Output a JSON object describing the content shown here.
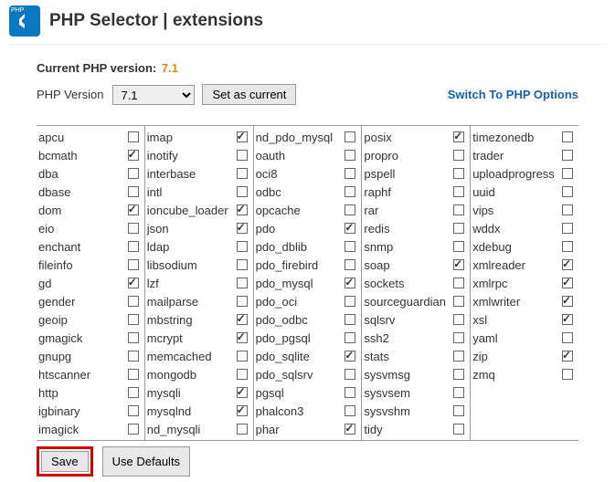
{
  "page_title": "PHP Selector | extensions",
  "current_version_label": "Current PHP version:",
  "current_version": "7.1",
  "php_version_label": "PHP Version",
  "selected_version": "7.1",
  "set_current_btn": "Set as current",
  "switch_link": "Switch To PHP Options",
  "save_btn": "Save",
  "defaults_btn": "Use Defaults",
  "columns": [
    [
      {
        "name": "apcu",
        "checked": false
      },
      {
        "name": "bcmath",
        "checked": true
      },
      {
        "name": "dba",
        "checked": false
      },
      {
        "name": "dbase",
        "checked": false
      },
      {
        "name": "dom",
        "checked": true
      },
      {
        "name": "eio",
        "checked": false
      },
      {
        "name": "enchant",
        "checked": false
      },
      {
        "name": "fileinfo",
        "checked": false
      },
      {
        "name": "gd",
        "checked": true
      },
      {
        "name": "gender",
        "checked": false
      },
      {
        "name": "geoip",
        "checked": false
      },
      {
        "name": "gmagick",
        "checked": false
      },
      {
        "name": "gnupg",
        "checked": false
      },
      {
        "name": "htscanner",
        "checked": false
      },
      {
        "name": "http",
        "checked": false
      },
      {
        "name": "igbinary",
        "checked": false
      },
      {
        "name": "imagick",
        "checked": false
      }
    ],
    [
      {
        "name": "imap",
        "checked": true
      },
      {
        "name": "inotify",
        "checked": false
      },
      {
        "name": "interbase",
        "checked": false
      },
      {
        "name": "intl",
        "checked": false
      },
      {
        "name": "ioncube_loader",
        "checked": true
      },
      {
        "name": "json",
        "checked": true
      },
      {
        "name": "ldap",
        "checked": false
      },
      {
        "name": "libsodium",
        "checked": false
      },
      {
        "name": "lzf",
        "checked": false
      },
      {
        "name": "mailparse",
        "checked": false
      },
      {
        "name": "mbstring",
        "checked": true
      },
      {
        "name": "mcrypt",
        "checked": true
      },
      {
        "name": "memcached",
        "checked": false
      },
      {
        "name": "mongodb",
        "checked": false
      },
      {
        "name": "mysqli",
        "checked": true
      },
      {
        "name": "mysqlnd",
        "checked": true
      },
      {
        "name": "nd_mysqli",
        "checked": false
      }
    ],
    [
      {
        "name": "nd_pdo_mysql",
        "checked": false
      },
      {
        "name": "oauth",
        "checked": false
      },
      {
        "name": "oci8",
        "checked": false
      },
      {
        "name": "odbc",
        "checked": false
      },
      {
        "name": "opcache",
        "checked": false
      },
      {
        "name": "pdo",
        "checked": true
      },
      {
        "name": "pdo_dblib",
        "checked": false
      },
      {
        "name": "pdo_firebird",
        "checked": false
      },
      {
        "name": "pdo_mysql",
        "checked": true
      },
      {
        "name": "pdo_oci",
        "checked": false
      },
      {
        "name": "pdo_odbc",
        "checked": false
      },
      {
        "name": "pdo_pgsql",
        "checked": false
      },
      {
        "name": "pdo_sqlite",
        "checked": true
      },
      {
        "name": "pdo_sqlsrv",
        "checked": false
      },
      {
        "name": "pgsql",
        "checked": false
      },
      {
        "name": "phalcon3",
        "checked": false
      },
      {
        "name": "phar",
        "checked": true
      }
    ],
    [
      {
        "name": "posix",
        "checked": true
      },
      {
        "name": "propro",
        "checked": false
      },
      {
        "name": "pspell",
        "checked": false
      },
      {
        "name": "raphf",
        "checked": false
      },
      {
        "name": "rar",
        "checked": false
      },
      {
        "name": "redis",
        "checked": false
      },
      {
        "name": "snmp",
        "checked": false
      },
      {
        "name": "soap",
        "checked": true
      },
      {
        "name": "sockets",
        "checked": false
      },
      {
        "name": "sourceguardian",
        "checked": false
      },
      {
        "name": "sqlsrv",
        "checked": false
      },
      {
        "name": "ssh2",
        "checked": false
      },
      {
        "name": "stats",
        "checked": false
      },
      {
        "name": "sysvmsg",
        "checked": false
      },
      {
        "name": "sysvsem",
        "checked": false
      },
      {
        "name": "sysvshm",
        "checked": false
      },
      {
        "name": "tidy",
        "checked": false
      }
    ],
    [
      {
        "name": "timezonedb",
        "checked": false
      },
      {
        "name": "trader",
        "checked": false
      },
      {
        "name": "uploadprogress",
        "checked": false
      },
      {
        "name": "uuid",
        "checked": false
      },
      {
        "name": "vips",
        "checked": false
      },
      {
        "name": "wddx",
        "checked": false
      },
      {
        "name": "xdebug",
        "checked": false
      },
      {
        "name": "xmlreader",
        "checked": true
      },
      {
        "name": "xmlrpc",
        "checked": true
      },
      {
        "name": "xmlwriter",
        "checked": true
      },
      {
        "name": "xsl",
        "checked": true
      },
      {
        "name": "yaml",
        "checked": false
      },
      {
        "name": "zip",
        "checked": true
      },
      {
        "name": "zmq",
        "checked": false
      }
    ]
  ]
}
